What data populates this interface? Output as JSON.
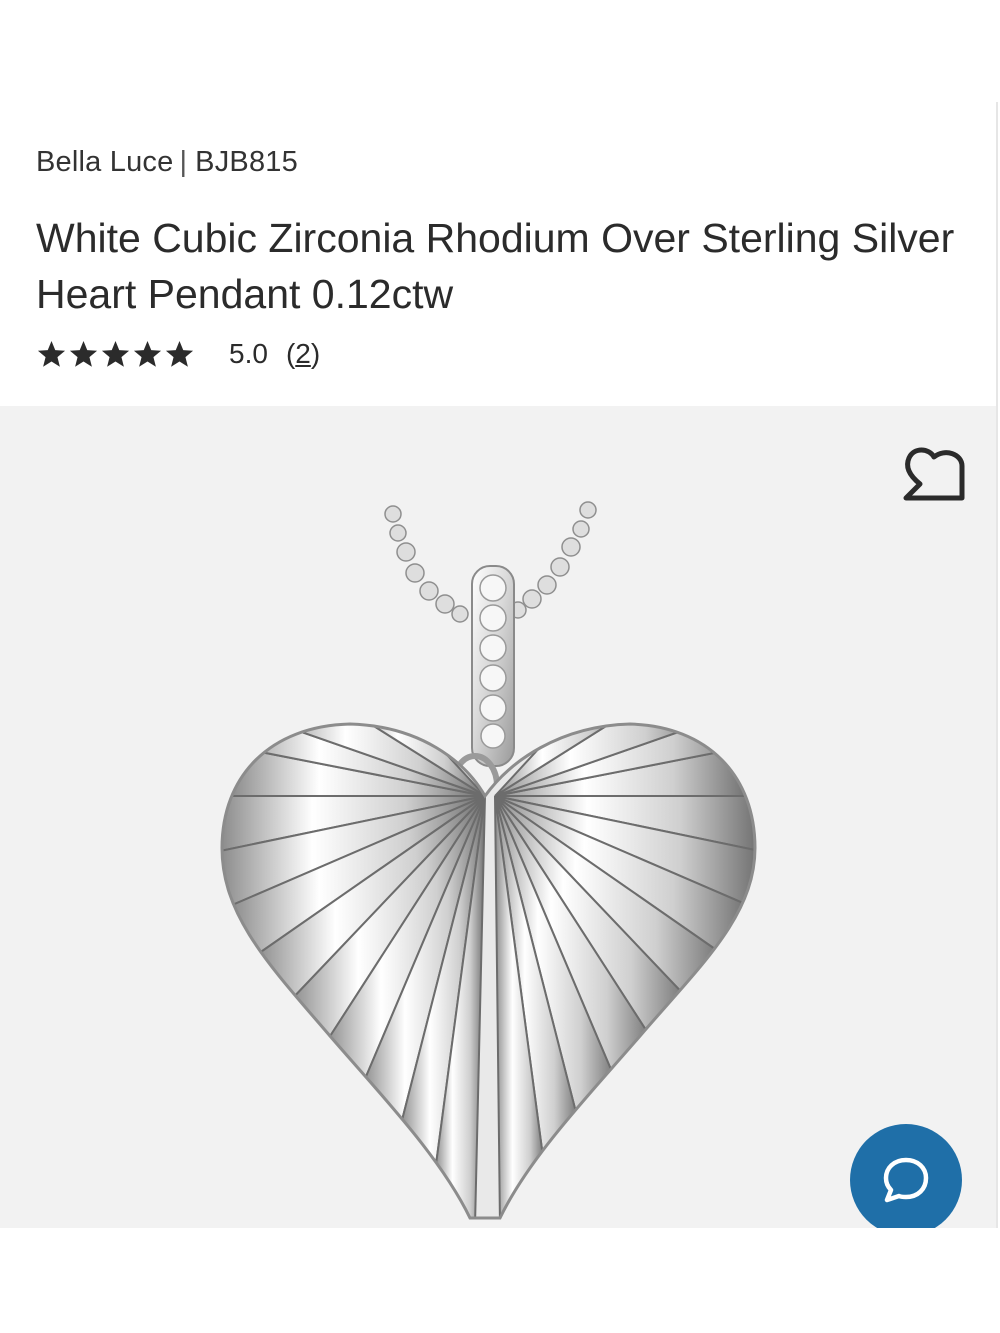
{
  "product": {
    "brand": "Bella Luce",
    "separator": "|",
    "sku": "BJB815",
    "title": "White Cubic Zirconia Rhodium Over Sterling Silver Heart Pendant 0.12ctw",
    "rating": {
      "stars": 5,
      "value": "5.0",
      "review_open": "(",
      "review_count": "2",
      "review_close": ")"
    }
  },
  "icons": {
    "star": "star-filled-icon",
    "wishlist": "heart-outline-icon",
    "chat": "chat-bubble-icon"
  },
  "colors": {
    "text": "#2b2b2b",
    "image_bg": "#f2f2f2",
    "chat_button": "#1f6fa8"
  }
}
